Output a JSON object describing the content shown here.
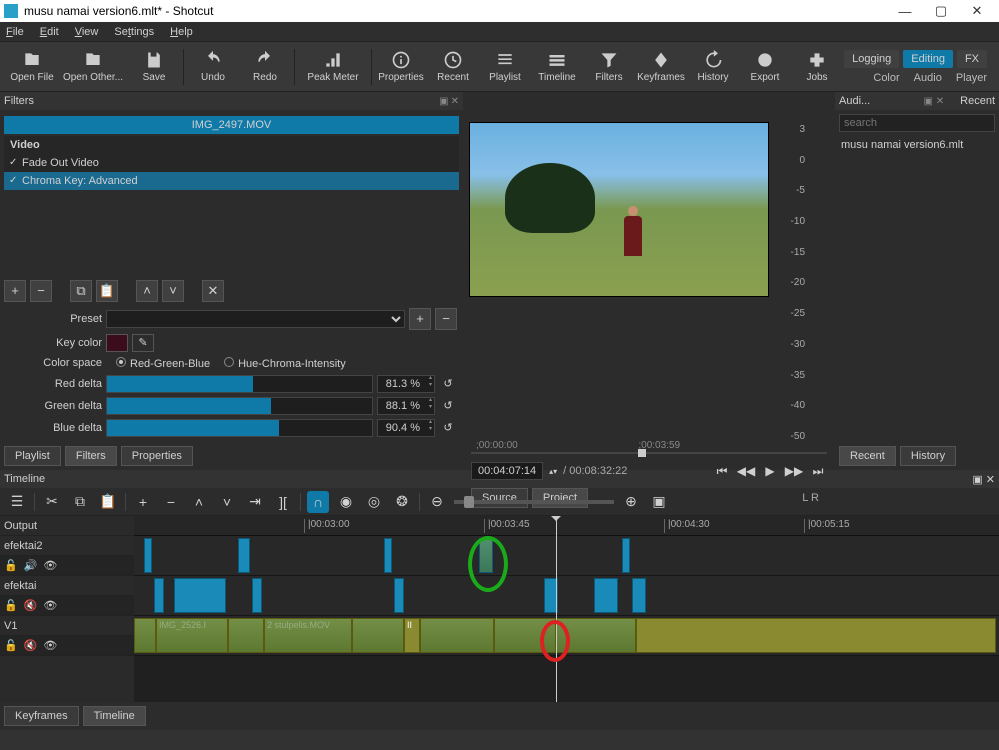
{
  "titlebar": {
    "title": "musu namai version6.mlt* - Shotcut"
  },
  "menubar": {
    "file": "File",
    "edit": "Edit",
    "view": "View",
    "settings": "Settings",
    "help": "Help"
  },
  "toolbar": {
    "open_file": "Open File",
    "open_other": "Open Other...",
    "save": "Save",
    "undo": "Undo",
    "redo": "Redo",
    "peak_meter": "Peak Meter",
    "properties": "Properties",
    "recent": "Recent",
    "playlist": "Playlist",
    "timeline": "Timeline",
    "filters": "Filters",
    "keyframes": "Keyframes",
    "history": "History",
    "export": "Export",
    "jobs": "Jobs"
  },
  "modes": {
    "logging": "Logging",
    "editing": "Editing",
    "fx": "FX",
    "color": "Color",
    "audio": "Audio",
    "player": "Player"
  },
  "filters": {
    "header": "Filters",
    "clip": "IMG_2497.MOV",
    "group": "Video",
    "items": [
      "Fade Out Video",
      "Chroma Key: Advanced"
    ],
    "preset": "Preset",
    "key_color": "Key color",
    "color_space": "Color space",
    "rgb": "Red-Green-Blue",
    "hci": "Hue-Chroma-Intensity",
    "red": {
      "label": "Red delta",
      "val": "81.3 %",
      "pct": 55
    },
    "green": {
      "label": "Green delta",
      "val": "88.1 %",
      "pct": 62
    },
    "blue": {
      "label": "Blue delta",
      "val": "90.4 %",
      "pct": 65
    },
    "tabs": {
      "playlist": "Playlist",
      "filters": "Filters",
      "properties": "Properties"
    }
  },
  "player": {
    "t1": ";00:00:00",
    "t2": ";00:03:59",
    "pos": "00:04:07:14",
    "total": "/ 00:08:32:22",
    "source": "Source",
    "project": "Project",
    "lr": "L  R"
  },
  "audio_panel": {
    "header": "Audi...",
    "ticks": [
      "3",
      "0",
      "-5",
      "-10",
      "-15",
      "-20",
      "-25",
      "-30",
      "-35",
      "-40",
      "-50"
    ]
  },
  "recent": {
    "header": "Recent",
    "search_ph": "search",
    "item": "musu namai version6.mlt",
    "tab_recent": "Recent",
    "tab_history": "History"
  },
  "timeline": {
    "header": "Timeline",
    "output": "Output",
    "track1": "efektai2",
    "track2": "efektai",
    "track3": "V1",
    "ruler": [
      "|00:03:00",
      "|00:03:45",
      "|00:04:30",
      "|00:05:15"
    ],
    "clip1": "IMG_2526.I",
    "clip2": "2 stulpelis.MOV",
    "clip3": "II",
    "tab_kf": "Keyframes",
    "tab_tl": "Timeline"
  }
}
